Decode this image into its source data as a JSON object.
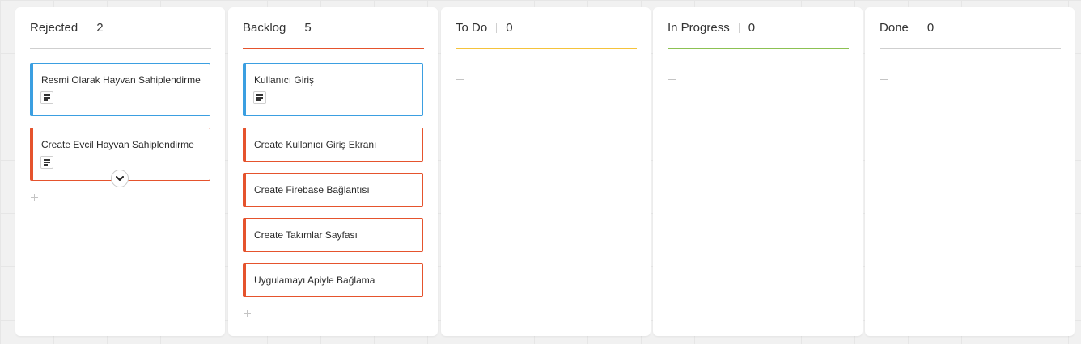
{
  "board": {
    "columns": [
      {
        "title": "Rejected",
        "count": "2",
        "line_color": "#cfcfcf",
        "cards": [
          {
            "title": "Resmi Olarak Hayvan Sahiplendirme",
            "color": "#3b9fe1",
            "has_notes": true
          },
          {
            "title": "Create Evcil Hayvan Sahiplendirme",
            "color": "#e5532d",
            "has_notes": true
          }
        ]
      },
      {
        "title": "Backlog",
        "count": "5",
        "line_color": "#e5532d",
        "cards": [
          {
            "title": "Kullanıcı Giriş",
            "color": "#3b9fe1",
            "has_notes": true
          },
          {
            "title": "Create Kullanıcı Giriş Ekranı",
            "color": "#e5532d",
            "has_notes": false
          },
          {
            "title": "Create Firebase Bağlantısı",
            "color": "#e5532d",
            "has_notes": false
          },
          {
            "title": "Create Takımlar Sayfası",
            "color": "#e5532d",
            "has_notes": false
          },
          {
            "title": "Uygulamayı Apiyle Bağlama",
            "color": "#e5532d",
            "has_notes": false
          }
        ]
      },
      {
        "title": "To Do",
        "count": "0",
        "line_color": "#f5c33b",
        "cards": []
      },
      {
        "title": "In Progress",
        "count": "0",
        "line_color": "#8cc152",
        "cards": []
      },
      {
        "title": "Done",
        "count": "0",
        "line_color": "#cfcfcf",
        "cards": []
      }
    ]
  }
}
